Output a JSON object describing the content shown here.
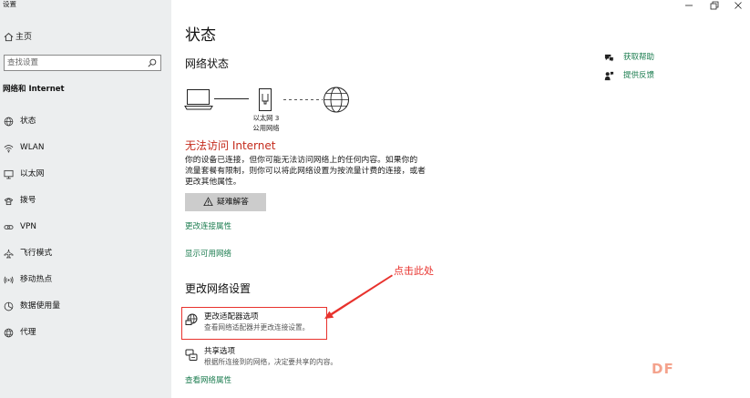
{
  "window": {
    "title": "设置",
    "controls": {
      "minimize_icon": "minimize-icon",
      "restore_icon": "restore-icon",
      "close_icon": "close-icon"
    }
  },
  "sidebar": {
    "home": {
      "icon": "home-icon",
      "label": "主页"
    },
    "search": {
      "placeholder": "查找设置",
      "value": "",
      "icon": "search-icon"
    },
    "section_title": "网络和 Internet",
    "items": [
      {
        "icon": "status-icon",
        "label": "状态"
      },
      {
        "icon": "wifi-icon",
        "label": "WLAN"
      },
      {
        "icon": "ethernet-icon",
        "label": "以太网"
      },
      {
        "icon": "dialup-icon",
        "label": "拨号"
      },
      {
        "icon": "vpn-icon",
        "label": "VPN"
      },
      {
        "icon": "airplane-icon",
        "label": "飞行模式"
      },
      {
        "icon": "hotspot-icon",
        "label": "移动热点"
      },
      {
        "icon": "data-usage-icon",
        "label": "数据使用量"
      },
      {
        "icon": "proxy-icon",
        "label": "代理"
      }
    ]
  },
  "main": {
    "title": "状态",
    "network_status": {
      "heading": "网络状态",
      "diagram_icons": [
        "computer-icon",
        "ethernet-adapter-icon",
        "globe-icon"
      ],
      "adapter_name": "以太网 3",
      "network_profile": "公用网络",
      "alert": "无法访问 Internet",
      "description_lines": [
        "你的设备已连接，但你可能无法访问网络上的任何内容。如果你的",
        "流量套餐有限制，则你可以将此网络设置为按流量计费的连接，或者",
        "更改其他属性。"
      ],
      "troubleshoot": {
        "icon": "warning-icon",
        "label": "疑难解答"
      },
      "change_connection_properties": "更改连接属性",
      "show_available_networks": "显示可用网络"
    },
    "change_network_settings": {
      "heading": "更改网络设置",
      "options": [
        {
          "icon": "adapter-icon",
          "title": "更改适配器选项",
          "description": "查看网络适配器并更改连接设置。"
        },
        {
          "icon": "sharing-icon",
          "title": "共享选项",
          "description": "根据所连接到的网络，决定要共享的内容。"
        }
      ],
      "view_network_properties": "查看网络属性"
    }
  },
  "help_panel": {
    "get_help": {
      "icon": "chat-help-icon",
      "label": "获取帮助"
    },
    "feedback": {
      "icon": "feedback-icon",
      "label": "提供反馈"
    }
  },
  "annotation": {
    "text": "点击此处"
  },
  "watermark": "DF",
  "colors": {
    "sidebar_background": "#eceeef",
    "link": "#1b7c4f",
    "alert": "#c42b1c",
    "annotation": "#e8322d",
    "button_background": "#cccccc",
    "watermark": "#f4a28c"
  }
}
